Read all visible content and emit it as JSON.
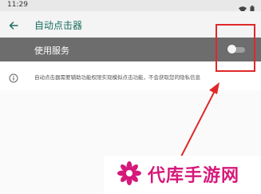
{
  "status_bar": {
    "time": "11:29",
    "icons": [
      "wifi-icon",
      "battery-icon"
    ]
  },
  "app_bar": {
    "title": "自动点击器",
    "back_icon": "arrow-back-icon"
  },
  "service_row": {
    "label": "使用服务",
    "toggle_on": false
  },
  "info": {
    "icon": "info-icon",
    "text": "自动点击器需要辅助功能权限实现模拟点击功能，不会获取您的隐私信息"
  },
  "watermark": {
    "text": "代库手游网"
  },
  "colors": {
    "accent": "#1a6e61",
    "row_highlight": "#6d6d6d",
    "annotation": "#e0282a",
    "watermark": "#d6197a"
  }
}
